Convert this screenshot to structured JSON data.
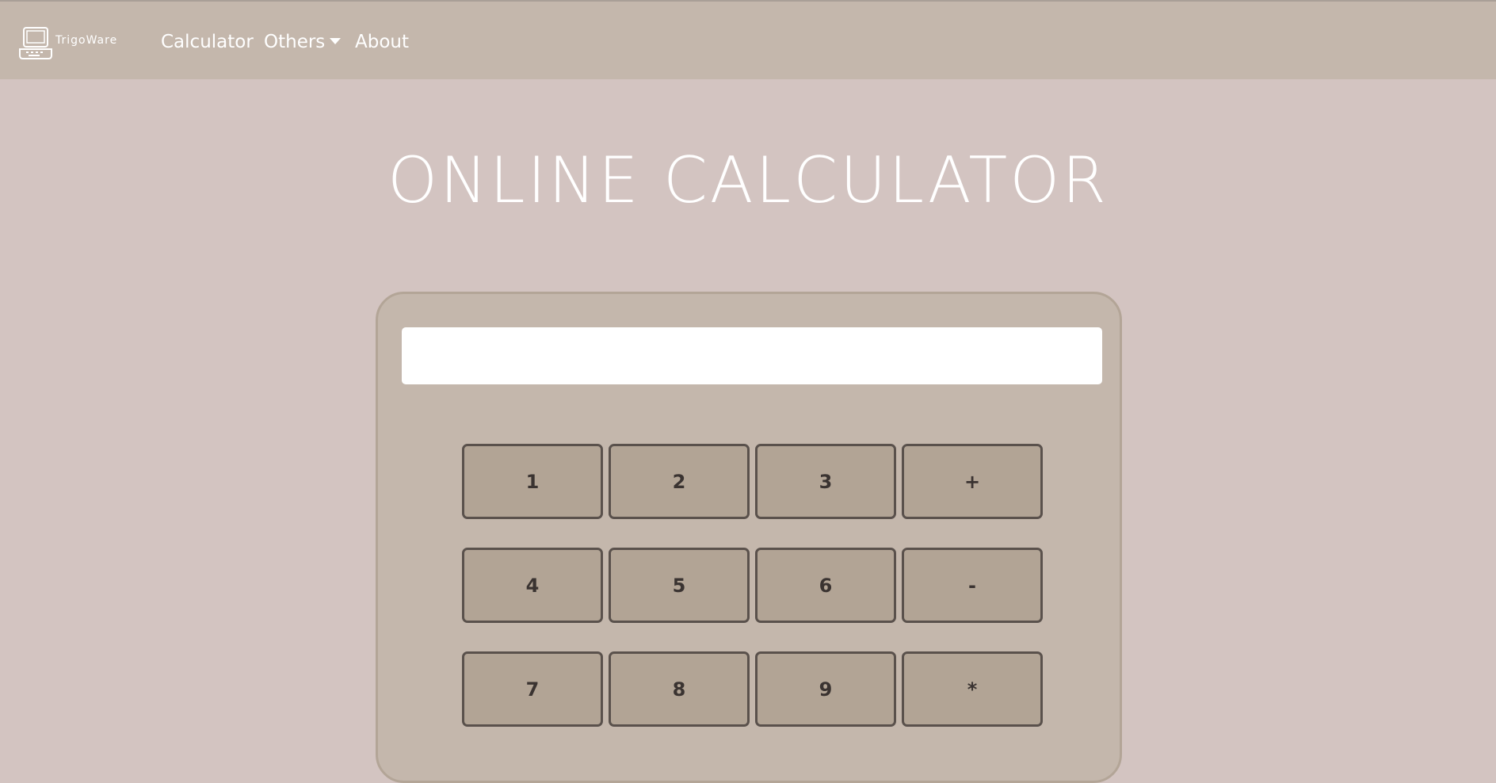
{
  "navbar": {
    "brand_text": "TrigoWare",
    "links": [
      "Calculator",
      "Others",
      "About"
    ]
  },
  "page": {
    "title": "ONLINE CALCULATOR"
  },
  "calculator": {
    "display_value": "",
    "keys": [
      [
        "1",
        "2",
        "3",
        "+"
      ],
      [
        "4",
        "5",
        "6",
        "-"
      ],
      [
        "7",
        "8",
        "9",
        "*"
      ]
    ]
  },
  "colors": {
    "page_background": "#d3c4c1",
    "navbar_background": "#c4b7ac",
    "calculator_body": "#c4b7ac",
    "key_background": "#b2a495",
    "key_border": "#5a514c",
    "text_white": "#ffffff"
  }
}
